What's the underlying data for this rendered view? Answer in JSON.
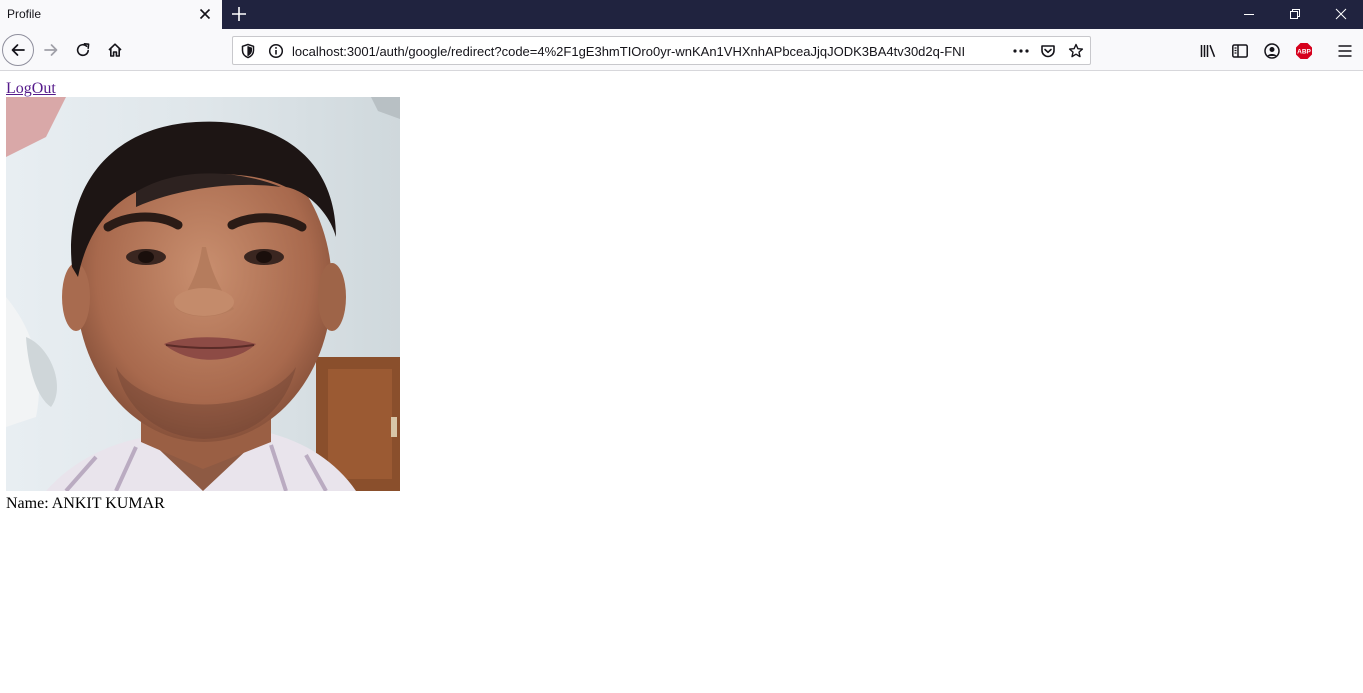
{
  "browser": {
    "tab": {
      "title": "Profile"
    },
    "url": "localhost:3001/auth/google/redirect?code=4%2F1gE3hmTIOro0yr-wnKAn1VHXnhAPbceaJjqJODK3BA4tv30d2q-FNI",
    "icons": {
      "back": "back-arrow-icon",
      "forward": "forward-arrow-icon",
      "reload": "reload-icon",
      "home": "home-icon",
      "shield": "tracking-protection-shield-icon",
      "info": "site-info-icon",
      "more": "page-actions-ellipsis-icon",
      "pocket": "pocket-icon",
      "star": "bookmark-star-icon",
      "library": "library-icon",
      "sidebar": "sidebar-icon",
      "account": "account-icon",
      "abp": "adblock-plus-icon",
      "menu": "hamburger-menu-icon"
    },
    "abp_badge": "ABP",
    "colors": {
      "tabstrip": "#20233f",
      "toolbar": "#f9f9fb",
      "abp_red": "#d6001c"
    }
  },
  "page": {
    "logout_label": "LogOut",
    "photo": "profile-photo",
    "name_line": "Name: ANKIT KUMAR",
    "colors": {
      "visited_link": "#551a8b"
    }
  }
}
